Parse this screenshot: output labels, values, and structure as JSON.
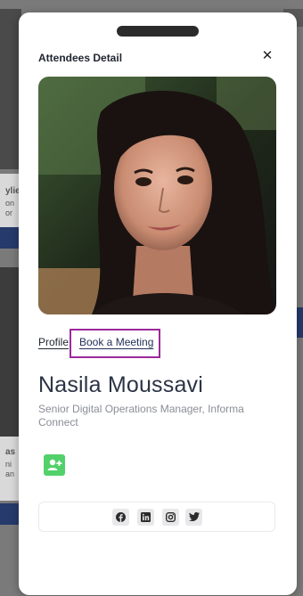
{
  "background_fragments": [
    "ylie",
    "on",
    "or",
    "as",
    "ni",
    "an"
  ],
  "modal": {
    "title": "Attendees Detail",
    "close_icon": "close-icon"
  },
  "tabs": {
    "profile": "Profile",
    "book_meeting": "Book a Meeting"
  },
  "attendee": {
    "name": "Nasila Moussavi",
    "role": "Senior Digital Operations Manager, Informa Connect"
  },
  "actions": {
    "add_contact_icon": "add-contact-icon"
  },
  "social_icons": [
    "facebook-icon",
    "linkedin-icon",
    "instagram-icon",
    "twitter-icon"
  ],
  "colors": {
    "add_contact": "#52d16a",
    "highlight": "#9b2a9b",
    "name": "#2b3445"
  }
}
